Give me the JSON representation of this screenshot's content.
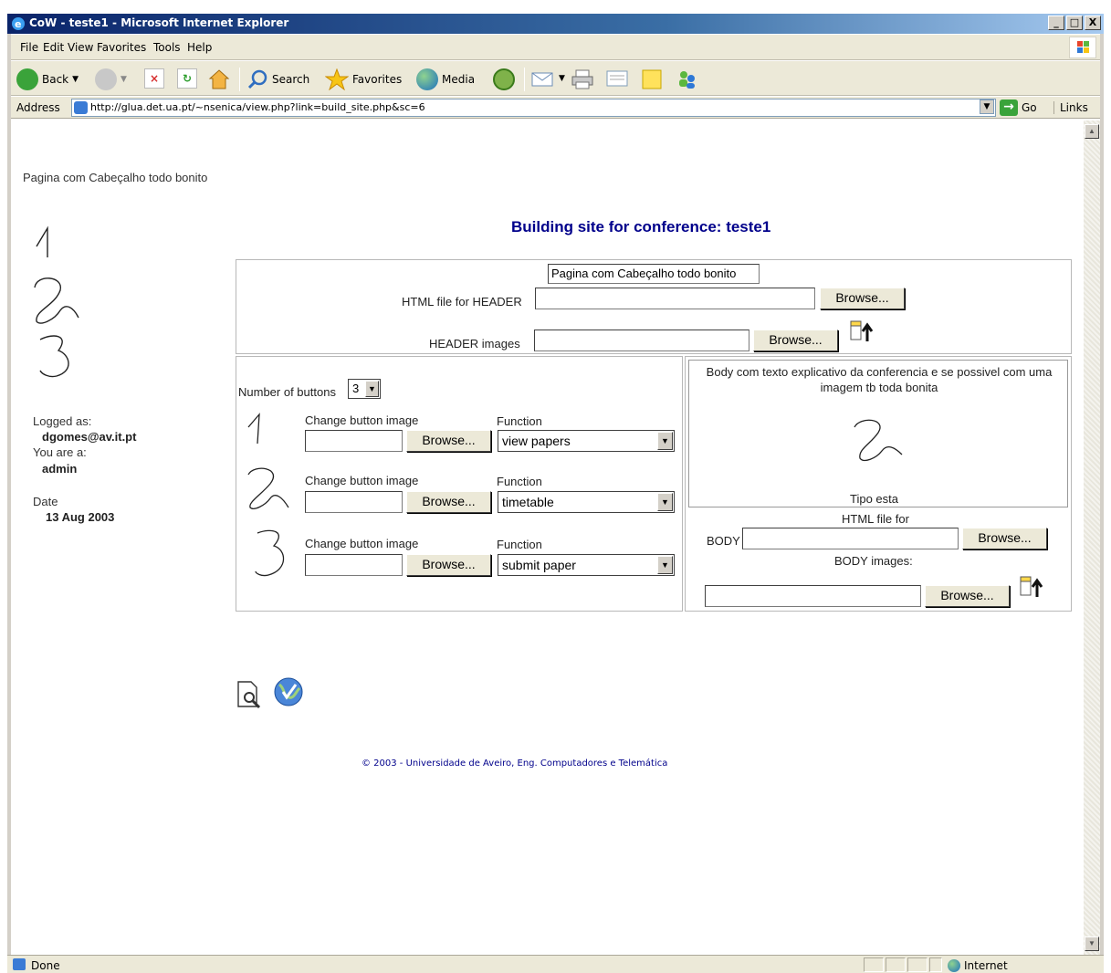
{
  "window": {
    "title": "CoW - teste1 - Microsoft Internet Explorer",
    "minimize": "_",
    "maximize": "□",
    "close": "X"
  },
  "menu": [
    "File",
    "Edit",
    "View",
    "Favorites",
    "Tools",
    "Help"
  ],
  "toolbar": {
    "back": "Back",
    "search": "Search",
    "favorites": "Favorites",
    "media": "Media"
  },
  "address": {
    "label": "Address",
    "url": "http://glua.det.ua.pt/~nsenica/view.php?link=build_site.php&sc=6",
    "go": "Go",
    "links": "Links"
  },
  "page": {
    "header_text": "Pagina com Cabeçalho todo bonito",
    "heading": "Building site for conference: teste1",
    "sidebar": {
      "logged_as_label": "Logged as:",
      "logged_as_value": "dgomes@av.it.pt",
      "you_are_label": "You are a:",
      "you_are_value": "admin",
      "date_label": "Date",
      "date_value": "13 Aug 2003"
    },
    "header_section": {
      "preview_value": "Pagina com Cabeçalho todo bonito",
      "html_file_label": "HTML file for HEADER",
      "images_label": "HEADER images",
      "browse": "Browse..."
    },
    "buttons_section": {
      "number_label": "Number of buttons",
      "number_value": "3",
      "change_label": "Change button image",
      "function_label": "Function",
      "browse": "Browse...",
      "rows": [
        {
          "digit": "1",
          "function": "view papers"
        },
        {
          "digit": "2",
          "function": "timetable"
        },
        {
          "digit": "3",
          "function": "submit paper"
        }
      ]
    },
    "body_section": {
      "preview_text": "Body com texto explicativo da conferencia e se possivel com uma imagem tb toda bonita",
      "caption": "Tipo esta",
      "html_file_label": "HTML file for",
      "body_label": "BODY",
      "images_label": "BODY images:",
      "browse": "Browse..."
    },
    "footer": "© 2003 - Universidade de Aveiro, Eng. Computadores e Telemática"
  },
  "status": {
    "text": "Done",
    "zone": "Internet"
  }
}
